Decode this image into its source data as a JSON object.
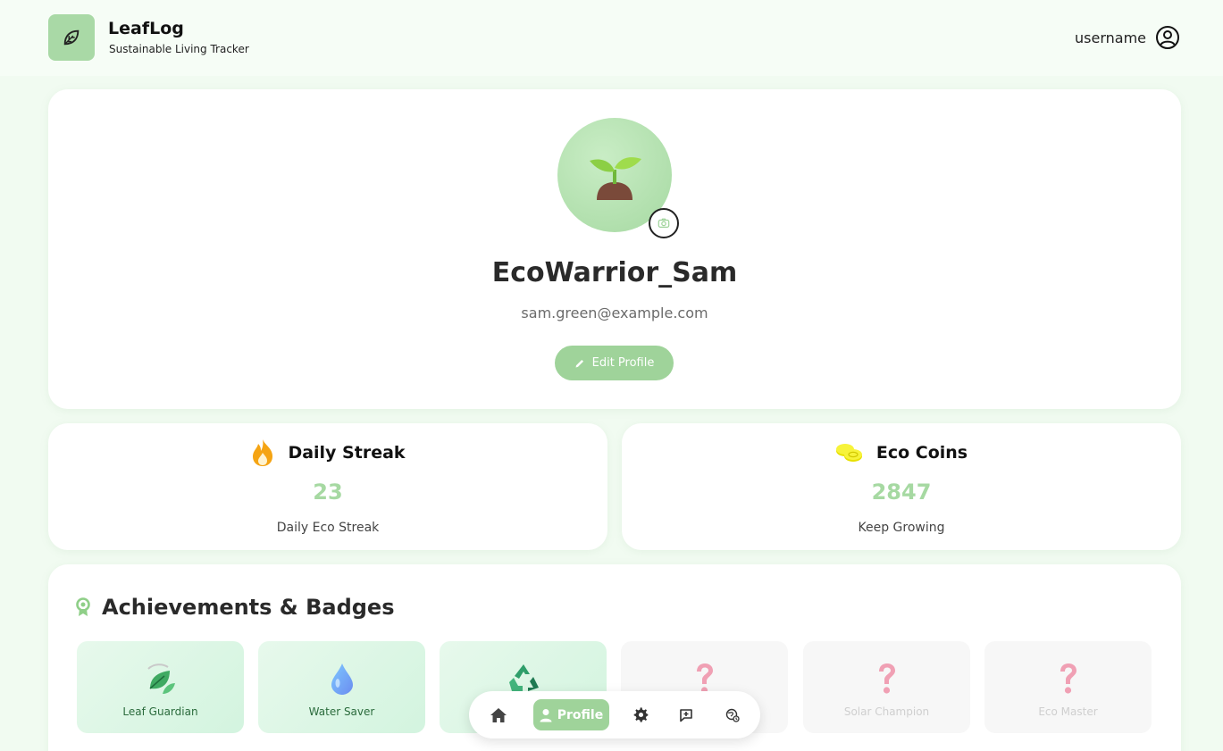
{
  "header": {
    "brand_name": "LeafLog",
    "brand_tagline": "Sustainable Living Tracker",
    "username": "username",
    "logo_icon": "leaf-icon",
    "user_icon": "user-circle-icon"
  },
  "profile": {
    "display_name": "EcoWarrior_Sam",
    "email": "sam.green@example.com",
    "edit_label": "Edit Profile",
    "avatar_icon": "seedling-icon",
    "camera_icon": "camera-icon"
  },
  "stats": [
    {
      "title": "Daily Streak",
      "value": "23",
      "caption": "Daily Eco Streak",
      "icon": "fire-icon"
    },
    {
      "title": "Eco Coins",
      "value": "2847",
      "caption": "Keep Growing",
      "icon": "coins-icon"
    }
  ],
  "achievements": {
    "title": "Achievements & Badges",
    "icon": "award-ribbon-icon",
    "badges": [
      {
        "label": "Leaf Guardian",
        "unlocked": true,
        "icon": "leaf-guardian-icon"
      },
      {
        "label": "Water Saver",
        "unlocked": true,
        "icon": "water-drop-icon"
      },
      {
        "label": "",
        "unlocked": true,
        "icon": "recycle-icon"
      },
      {
        "label": "",
        "unlocked": false,
        "icon": "question-mark-icon"
      },
      {
        "label": "Solar Champion",
        "unlocked": false,
        "icon": "question-mark-icon"
      },
      {
        "label": "Eco Master",
        "unlocked": false,
        "icon": "question-mark-icon"
      }
    ]
  },
  "nav": {
    "items": [
      {
        "label": "",
        "icon": "home-icon",
        "active": false
      },
      {
        "label": "Profile",
        "icon": "user-icon",
        "active": true
      },
      {
        "label": "",
        "icon": "settings-gear-icon",
        "active": false
      },
      {
        "label": "",
        "icon": "chat-add-icon",
        "active": false
      },
      {
        "label": "",
        "icon": "eco-globe-icon",
        "active": false
      }
    ]
  },
  "colors": {
    "accent_green": "#9fd39a",
    "value_green": "#a6d9a2",
    "page_background": "#f1fbf1",
    "badge_locked_pink": "#f0a0b4"
  }
}
